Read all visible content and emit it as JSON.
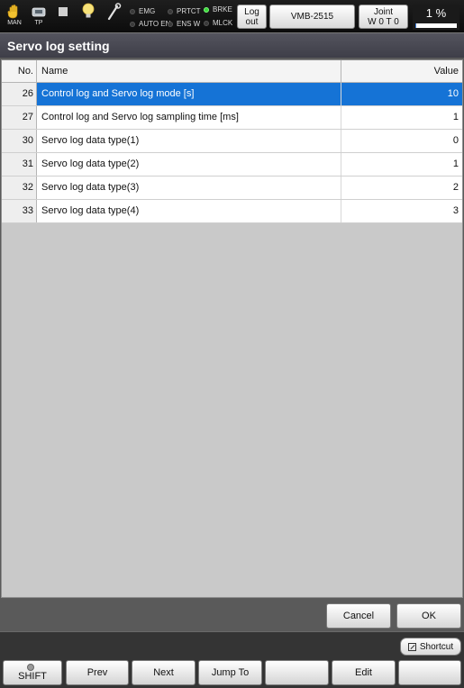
{
  "status_bar": {
    "mode_label": "MAN",
    "pendant_label": "TP",
    "indicators": [
      {
        "label": "EMG",
        "on": false
      },
      {
        "label": "AUTO EN",
        "on": false
      },
      {
        "label": "PRTCT",
        "on": false
      },
      {
        "label": "ENS W",
        "on": false
      },
      {
        "label": "BRKE",
        "on": true
      },
      {
        "label": "MLCK",
        "on": false
      }
    ],
    "logout": {
      "line1": "Log",
      "line2": "out"
    },
    "robot_model": "VMB-2515",
    "coord": {
      "line1": "Joint",
      "line2": "W 0 T 0"
    },
    "speed": {
      "label": "1 %",
      "percent": 1
    },
    "icons": [
      "hand-icon",
      "teach-pendant-icon",
      "stop-square-icon",
      "lightbulb-icon",
      "wrench-icon"
    ]
  },
  "page": {
    "title": "Servo log setting"
  },
  "table": {
    "headers": {
      "no": "No.",
      "name": "Name",
      "value": "Value"
    },
    "rows": [
      {
        "no": "26",
        "name": "Control log and Servo log mode [s]",
        "value": "10",
        "selected": true
      },
      {
        "no": "27",
        "name": "Control log and Servo log sampling time [ms]",
        "value": "1",
        "selected": false
      },
      {
        "no": "30",
        "name": "Servo log data type(1)",
        "value": "0",
        "selected": false
      },
      {
        "no": "31",
        "name": "Servo log data type(2)",
        "value": "1",
        "selected": false
      },
      {
        "no": "32",
        "name": "Servo log data type(3)",
        "value": "2",
        "selected": false
      },
      {
        "no": "33",
        "name": "Servo log data type(4)",
        "value": "3",
        "selected": false
      }
    ]
  },
  "dialog_buttons": {
    "cancel": "Cancel",
    "ok": "OK"
  },
  "shortcut": {
    "label": "Shortcut"
  },
  "function_keys": {
    "shift": "SHIFT",
    "f1": "Prev",
    "f2": "Next",
    "f3": "Jump To",
    "f4": "",
    "f5": "Edit",
    "f6": ""
  },
  "colors": {
    "selection": "#1573d6",
    "status_on": "#3bd83b",
    "speed_fill": "#3b7ddd"
  }
}
